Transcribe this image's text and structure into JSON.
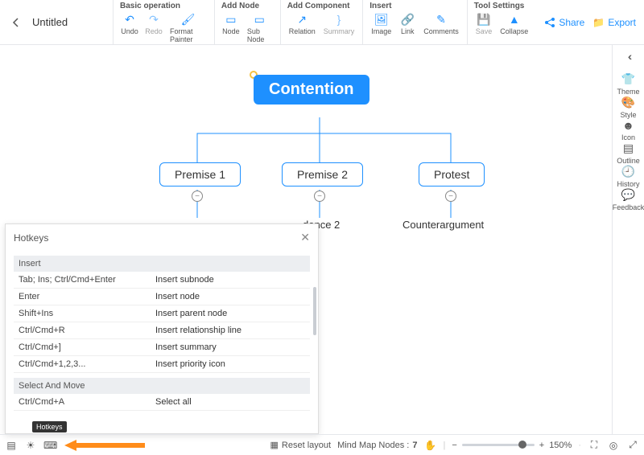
{
  "title": "Untitled",
  "toolbar": {
    "groups": [
      {
        "header": "Basic operation",
        "items": [
          {
            "id": "undo",
            "label": "Undo",
            "icon": "↶"
          },
          {
            "id": "redo",
            "label": "Redo",
            "icon": "↷",
            "disabled": true
          },
          {
            "id": "format-painter",
            "label": "Format Painter",
            "icon": "🖌"
          }
        ]
      },
      {
        "header": "Add Node",
        "items": [
          {
            "id": "node",
            "label": "Node",
            "icon": "▭"
          },
          {
            "id": "subnode",
            "label": "Sub Node",
            "icon": "▭"
          }
        ]
      },
      {
        "header": "Add Component",
        "items": [
          {
            "id": "relation",
            "label": "Relation",
            "icon": "↗"
          },
          {
            "id": "summary",
            "label": "Summary",
            "icon": "}",
            "disabled": true
          }
        ]
      },
      {
        "header": "Insert",
        "items": [
          {
            "id": "image",
            "label": "Image",
            "icon": "🖼"
          },
          {
            "id": "link",
            "label": "Link",
            "icon": "🔗"
          },
          {
            "id": "comments",
            "label": "Comments",
            "icon": "✎"
          }
        ]
      },
      {
        "header": "Tool Settings",
        "items": [
          {
            "id": "save",
            "label": "Save",
            "icon": "💾",
            "disabled": true
          },
          {
            "id": "collapse",
            "label": "Collapse",
            "icon": "▲"
          }
        ]
      }
    ]
  },
  "rightActions": [
    {
      "id": "share",
      "label": "Share",
      "icon": "share"
    },
    {
      "id": "export",
      "label": "Export",
      "icon": "folder"
    }
  ],
  "rightPanel": [
    {
      "id": "theme",
      "label": "Theme",
      "icon": "👕"
    },
    {
      "id": "style",
      "label": "Style",
      "icon": "🎨"
    },
    {
      "id": "icon",
      "label": "Icon",
      "icon": "☻"
    },
    {
      "id": "outline",
      "label": "Outline",
      "icon": "▤"
    },
    {
      "id": "history",
      "label": "History",
      "icon": "🕘"
    },
    {
      "id": "feedback",
      "label": "Feedback",
      "icon": "💬"
    }
  ],
  "mindmap": {
    "root": "Contention",
    "children": [
      {
        "label": "Premise 1"
      },
      {
        "label": "Premise 2",
        "children": [
          {
            "label": "dence 2"
          }
        ]
      },
      {
        "label": "Protest",
        "children": [
          {
            "label": "Counterargument"
          }
        ]
      }
    ]
  },
  "hotkeys": {
    "title": "Hotkeys",
    "sections": [
      {
        "title": "Insert",
        "rows": [
          {
            "key": "Tab;  Ins;  Ctrl/Cmd+Enter",
            "desc": "Insert subnode"
          },
          {
            "key": "Enter",
            "desc": "Insert node"
          },
          {
            "key": "Shift+Ins",
            "desc": "Insert parent node"
          },
          {
            "key": "Ctrl/Cmd+R",
            "desc": "Insert relationship line"
          },
          {
            "key": "Ctrl/Cmd+]",
            "desc": "Insert summary"
          },
          {
            "key": "Ctrl/Cmd+1,2,3...",
            "desc": "Insert priority icon"
          }
        ]
      },
      {
        "title": "Select And Move",
        "rows": [
          {
            "key": "Ctrl/Cmd+A",
            "desc": "Select all"
          }
        ]
      }
    ]
  },
  "bottom": {
    "tooltip": "Hotkeys",
    "reset": "Reset layout",
    "nodesLabel": "Mind Map Nodes :",
    "nodesCount": "7",
    "zoom": "150%"
  }
}
